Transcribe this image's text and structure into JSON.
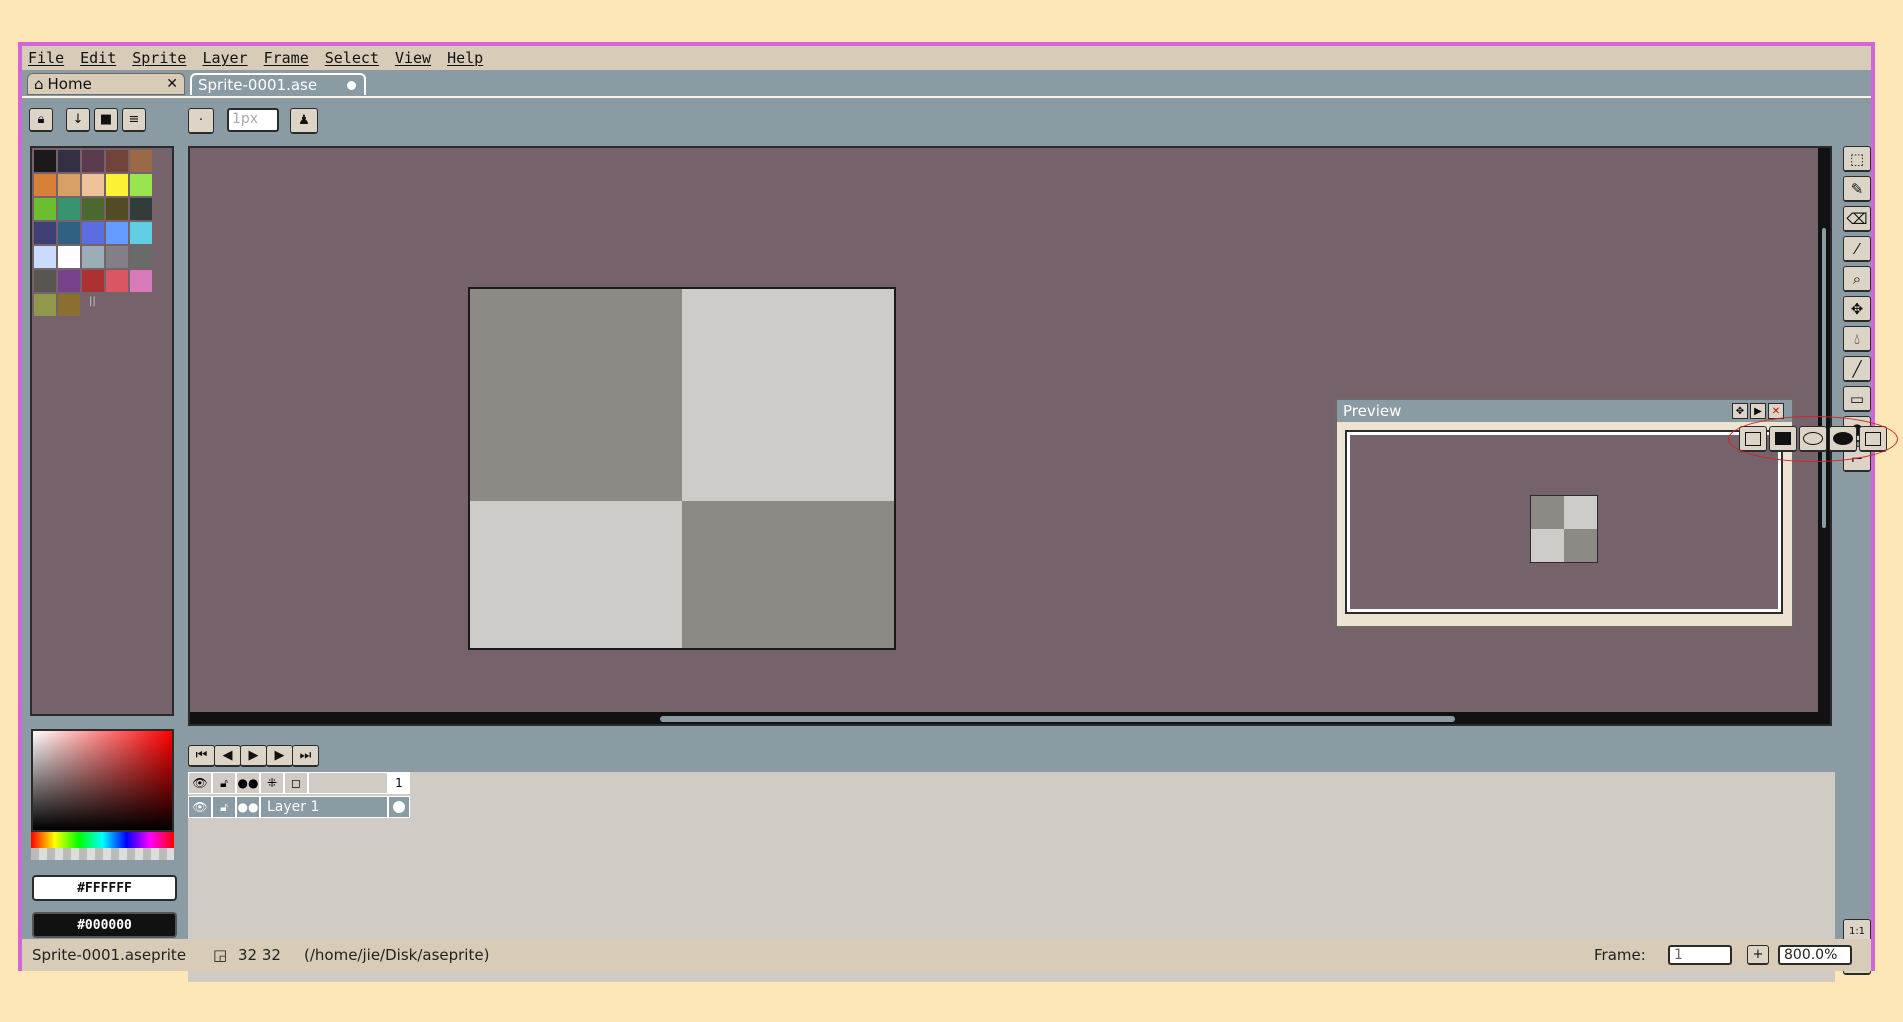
{
  "menu": [
    "File",
    "Edit",
    "Sprite",
    "Layer",
    "Frame",
    "Select",
    "View",
    "Help"
  ],
  "tabs": {
    "home": "Home",
    "active": "Sprite-0001.ase"
  },
  "toolbar": {
    "brush_size": "1px"
  },
  "palette": {
    "colors": [
      "#1a1a1a",
      "#333044",
      "#5a3a4c",
      "#70443b",
      "#9c6947",
      "#d88038",
      "#d9a066",
      "#eec39a",
      "#fbf236",
      "#99e550",
      "#6abe30",
      "#37946e",
      "#4b692f",
      "#524b24",
      "#323c39",
      "#3f3f74",
      "#306082",
      "#5b6ee1",
      "#639bff",
      "#5fcde4",
      "#cbdbfc",
      "#ffffff",
      "#9badb7",
      "#847e87",
      "#696a6a",
      "#595652",
      "#76428a",
      "#ac3232",
      "#d95763",
      "#d77bba",
      "#8f974a",
      "#8a6f30"
    ]
  },
  "colors": {
    "foreground": "#FFFFFF",
    "background": "#000000"
  },
  "preview": {
    "title": "Preview"
  },
  "timeline": {
    "frame_number": "1",
    "layer_name": "Layer 1"
  },
  "status": {
    "filename": "Sprite-0001.aseprite",
    "size": "32 32",
    "path": "(/home/jie/Disk/aseprite)",
    "frame_label": "Frame:",
    "frame_value": "1",
    "zoom": "800.0%"
  }
}
